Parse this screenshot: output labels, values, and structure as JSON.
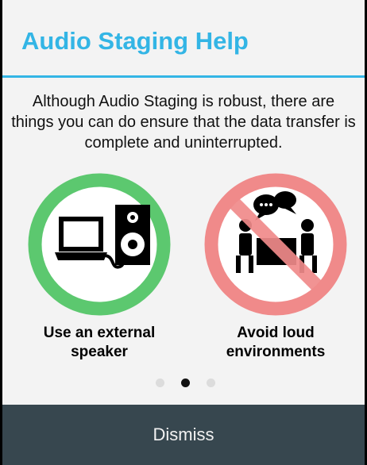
{
  "dialog": {
    "title": "Audio Staging Help",
    "message": "Although Audio Staging is robust, there are things you can do ensure that the data transfer is complete and uninterrupted.",
    "tips": [
      {
        "label": "Use an external speaker",
        "icon": "laptop-speaker-icon",
        "color": "#5cc86f"
      },
      {
        "label": "Avoid loud environments",
        "icon": "no-conversation-icon",
        "color": "#f08a8a"
      }
    ],
    "pager": {
      "count": 3,
      "active_index": 1
    },
    "dismiss_label": "Dismiss"
  },
  "colors": {
    "accent": "#33b5e5",
    "dialog_bg": "#f3f3f3",
    "button_bar": "#37474f"
  }
}
